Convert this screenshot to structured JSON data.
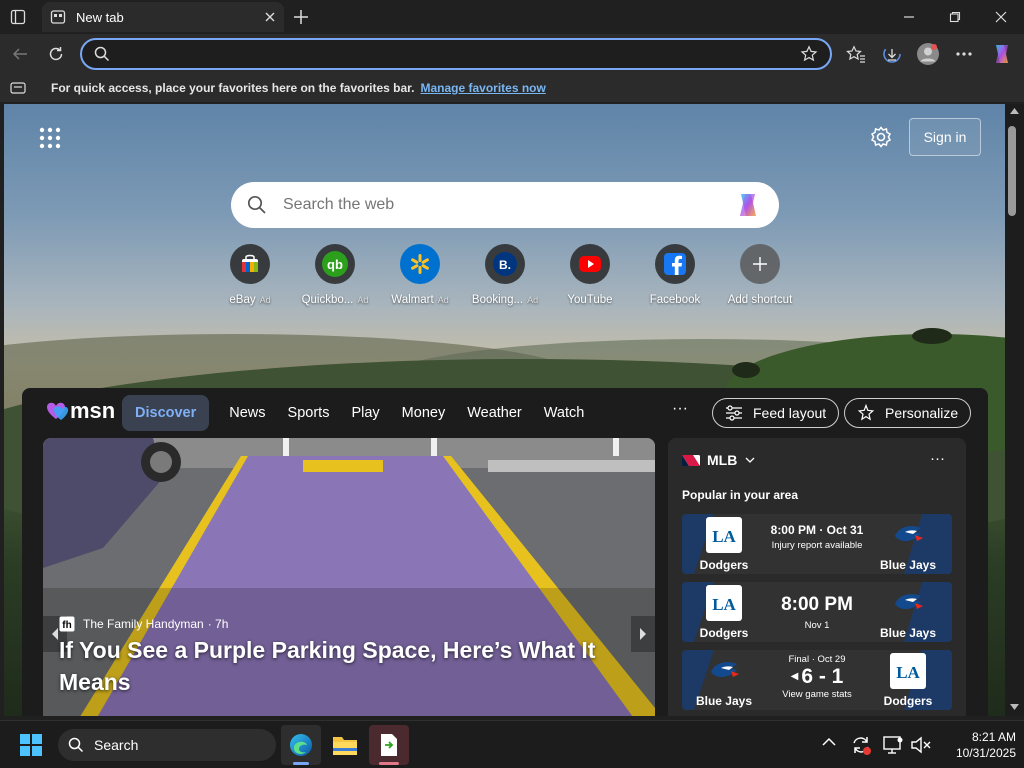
{
  "tab": {
    "title": "New tab"
  },
  "address": {
    "value": ""
  },
  "favbar": {
    "text": "For quick access, place your favorites here on the favorites bar.",
    "link": "Manage favorites now"
  },
  "newtab": {
    "signin": "Sign in",
    "search_placeholder": "Search the web",
    "shortcuts": [
      {
        "label": "eBay",
        "ad": "Ad",
        "icon": "ebay-icon",
        "color": "#3a3a3a"
      },
      {
        "label": "Quickbo...",
        "ad": "Ad",
        "icon": "quickbooks-icon",
        "color": "#2ca01c"
      },
      {
        "label": "Walmart",
        "ad": "Ad",
        "icon": "walmart-icon",
        "color": "#0071ce"
      },
      {
        "label": "Booking...",
        "ad": "Ad",
        "icon": "booking-icon",
        "color": "#003580"
      },
      {
        "label": "YouTube",
        "ad": "",
        "icon": "youtube-icon",
        "color": "#ff0000"
      },
      {
        "label": "Facebook",
        "ad": "",
        "icon": "facebook-icon",
        "color": "#1877f2"
      },
      {
        "label": "Add shortcut",
        "ad": "",
        "icon": "plus-icon",
        "color": "#555555"
      }
    ]
  },
  "feed": {
    "logo": "msn",
    "nav": [
      "Discover",
      "News",
      "Sports",
      "Play",
      "Money",
      "Weather",
      "Watch"
    ],
    "more": "···",
    "feed_layout": "Feed layout",
    "personalize": "Personalize",
    "hero": {
      "source": "The Family Handyman",
      "time": "· 7h",
      "title": "If You See a Purple Parking Space, Here’s What It Means"
    },
    "mlb": {
      "title": "MLB",
      "popular": "Popular in your area",
      "games": [
        {
          "left_team": "Dodgers",
          "right_team": "Blue Jays",
          "main": "8:00 PM · Oct 31",
          "sub": "Injury report available"
        },
        {
          "left_team": "Dodgers",
          "right_team": "Blue Jays",
          "main": "8:00 PM",
          "sub": "Nov 1"
        },
        {
          "left_team": "Blue Jays",
          "right_team": "Dodgers",
          "top": "Final · Oct 29",
          "main": "6 - 1",
          "sub": "View game stats"
        }
      ]
    }
  },
  "taskbar": {
    "search": "Search",
    "time": "8:21 AM",
    "date": "10/31/2025"
  },
  "colors": {
    "accent": "#7aa7f5",
    "link": "#79b6f2",
    "dodgers": "#005a9c",
    "bluejays": "#134a8e"
  }
}
